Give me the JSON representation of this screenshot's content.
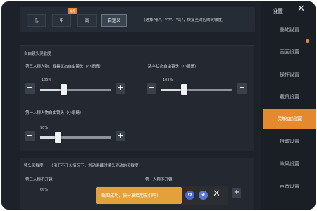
{
  "preset": {
    "options": [
      "低",
      "中",
      "高",
      "自定义"
    ],
    "selected": "自定义",
    "badge": "推荐",
    "hint": "（选择\"低\"、\"中\"、\"高\"，恢复至对应的灵敏度）"
  },
  "camera_section": {
    "title": "自由镜头灵敏度",
    "third_person": {
      "label": "第三人称人物、载具状态自由镜头（小眼睛）",
      "value": "105%",
      "level": 105
    },
    "parachute": {
      "label": "跳伞状态自由镜头（小眼睛）",
      "value": "105%",
      "level": 105
    },
    "first_person": {
      "label": "第一人称人物自由镜头（小眼睛）",
      "value": "90%",
      "level": 90
    }
  },
  "lens_section": {
    "title": "镜头灵敏度",
    "hint": "（用于不开火情况下，划动屏幕时镜头转动的灵敏度）",
    "third_no_scope": {
      "label": "第三人称不开镜",
      "value": "66%"
    },
    "first_no_scope": {
      "label": "第一人称不开镜"
    }
  },
  "controls": {
    "minus": "−",
    "plus": "+"
  },
  "sidebar": {
    "title": "设置",
    "close": "✕",
    "items": [
      "基础设置",
      "画面设置",
      "操作设置",
      "载具设置",
      "灵敏度设置",
      "拾取设置",
      "效果设置",
      "声音设置"
    ],
    "active_index": 4
  },
  "toast": {
    "text": "截图成功，快分享给朋友们吧!",
    "close": "✕"
  },
  "colors": {
    "accent": "#e5892f",
    "toast": "#e3a13c"
  }
}
